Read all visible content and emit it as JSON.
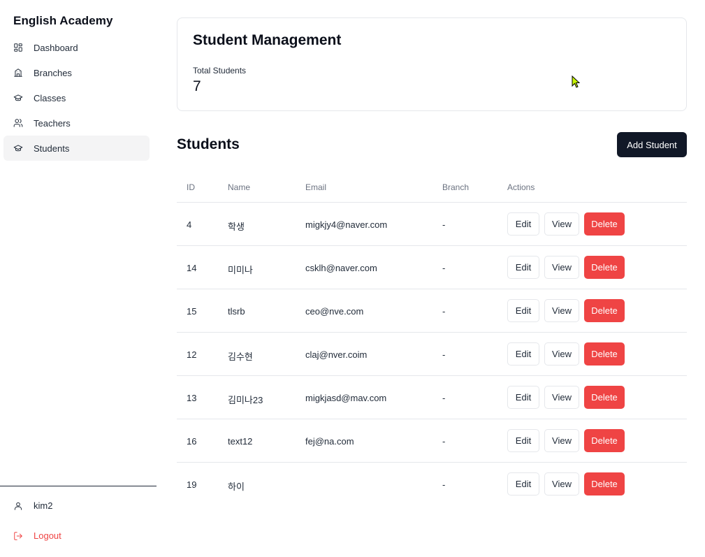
{
  "app": {
    "brand": "English Academy"
  },
  "sidebar": {
    "items": [
      {
        "label": "Dashboard",
        "icon": "dashboard-icon",
        "active": false
      },
      {
        "label": "Branches",
        "icon": "building-icon",
        "active": false
      },
      {
        "label": "Classes",
        "icon": "graduation-cap-icon",
        "active": false
      },
      {
        "label": "Teachers",
        "icon": "users-icon",
        "active": false
      },
      {
        "label": "Students",
        "icon": "graduation-cap-icon",
        "active": true
      }
    ],
    "user": {
      "name": "kim2",
      "icon": "user-icon"
    },
    "logout": {
      "label": "Logout",
      "icon": "logout-icon"
    }
  },
  "header": {
    "title": "Student Management",
    "stat_label": "Total Students",
    "stat_value": "7"
  },
  "students_section": {
    "title": "Students",
    "add_button": "Add Student"
  },
  "table": {
    "columns": [
      "ID",
      "Name",
      "Email",
      "Branch",
      "Actions"
    ],
    "rows": [
      {
        "id": "4",
        "name": "학생",
        "email": "migkjy4@naver.com",
        "branch": "-"
      },
      {
        "id": "14",
        "name": "미미나",
        "email": "csklh@naver.com",
        "branch": "-"
      },
      {
        "id": "15",
        "name": "tlsrb",
        "email": "ceo@nve.com",
        "branch": "-"
      },
      {
        "id": "12",
        "name": "김수현",
        "email": "claj@nver.coim",
        "branch": "-"
      },
      {
        "id": "13",
        "name": "김미나23",
        "email": "migkjasd@mav.com",
        "branch": "-"
      },
      {
        "id": "16",
        "name": "text12",
        "email": "fej@na.com",
        "branch": "-"
      },
      {
        "id": "19",
        "name": "하이",
        "email": "",
        "branch": "-"
      }
    ],
    "actions": {
      "edit": "Edit",
      "view": "View",
      "delete": "Delete"
    }
  },
  "colors": {
    "primary_dark": "#111827",
    "danger": "#ef4444",
    "border": "#e5e7eb",
    "active_nav_bg": "#f4f4f5"
  }
}
